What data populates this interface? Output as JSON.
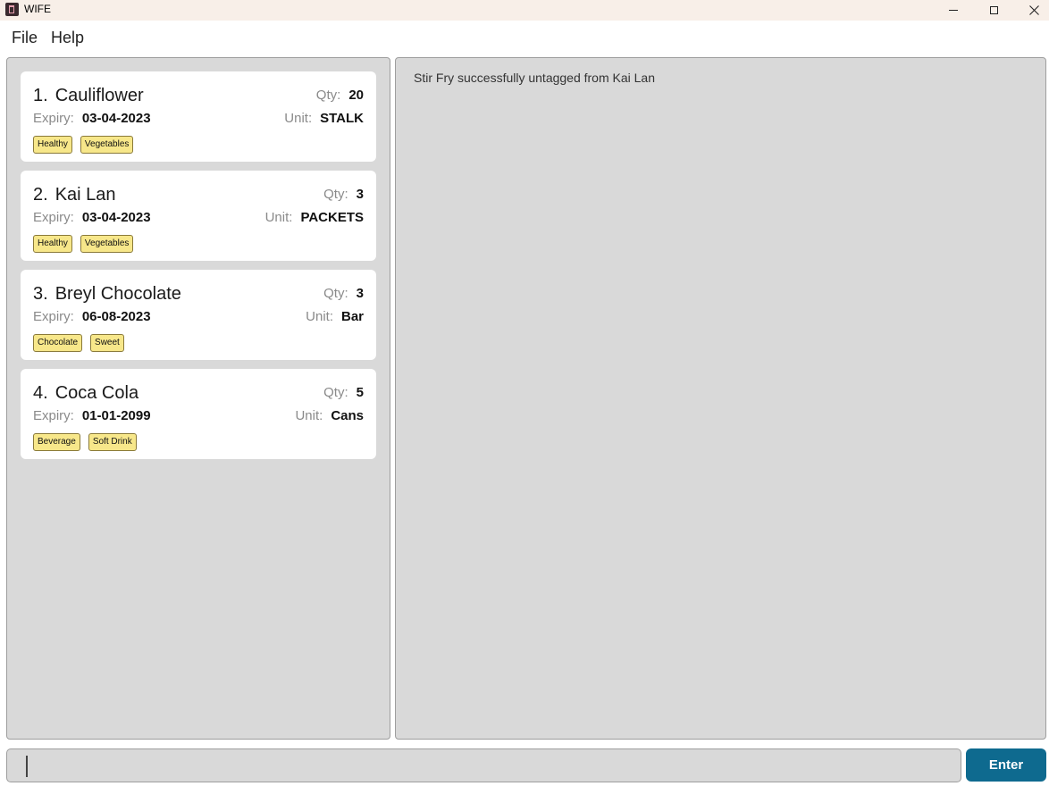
{
  "window": {
    "title": "WIFE",
    "icon": "app-icon"
  },
  "menu": {
    "items": [
      "File",
      "Help"
    ]
  },
  "food_list": {
    "items": [
      {
        "index": "1.",
        "name": "Cauliflower",
        "qty_label": "Qty:",
        "qty": "20",
        "expiry_label": "Expiry:",
        "expiry": "03-04-2023",
        "unit_label": "Unit:",
        "unit": "STALK",
        "tags": [
          "Healthy",
          "Vegetables"
        ]
      },
      {
        "index": "2.",
        "name": "Kai Lan",
        "qty_label": "Qty:",
        "qty": "3",
        "expiry_label": "Expiry:",
        "expiry": "03-04-2023",
        "unit_label": "Unit:",
        "unit": "PACKETS",
        "tags": [
          "Healthy",
          "Vegetables"
        ]
      },
      {
        "index": "3.",
        "name": "Breyl Chocolate",
        "qty_label": "Qty:",
        "qty": "3",
        "expiry_label": "Expiry:",
        "expiry": "06-08-2023",
        "unit_label": "Unit:",
        "unit": "Bar",
        "tags": [
          "Chocolate",
          "Sweet"
        ]
      },
      {
        "index": "4.",
        "name": "Coca Cola",
        "qty_label": "Qty:",
        "qty": "5",
        "expiry_label": "Expiry:",
        "expiry": "01-01-2099",
        "unit_label": "Unit:",
        "unit": "Cans",
        "tags": [
          "Beverage",
          "Soft Drink"
        ]
      }
    ]
  },
  "result_display": {
    "message": "Stir Fry successfully untagged from Kai Lan"
  },
  "command": {
    "value": "",
    "placeholder": "",
    "enter_label": "Enter"
  },
  "colors": {
    "tag_bg": "#f7e78a",
    "enter_button": "#0e6a8f",
    "panel_bg": "#d9d9d9",
    "titlebar_bg": "#f8efe8"
  }
}
